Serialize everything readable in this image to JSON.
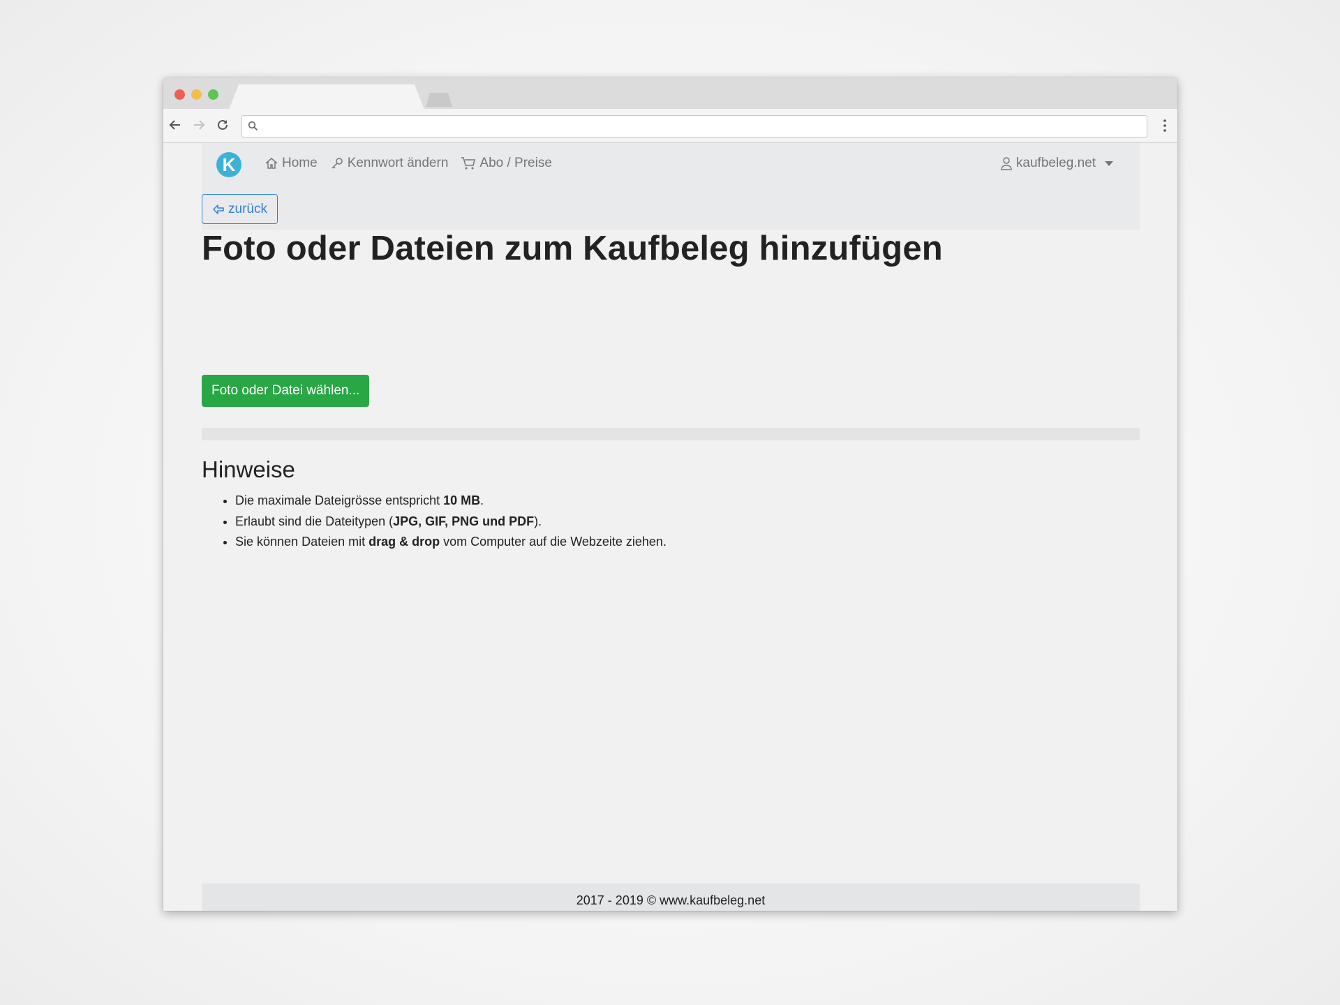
{
  "browser": {
    "address_value": "",
    "icons": [
      "back-arrow-icon",
      "forward-arrow-icon",
      "reload-icon",
      "search-icon",
      "menu-dots-icon"
    ]
  },
  "navbar": {
    "brand_letter": "K",
    "links": [
      {
        "label": "Home",
        "icon": "home-icon"
      },
      {
        "label": "Kennwort ändern",
        "icon": "key-icon"
      },
      {
        "label": "Abo / Preise",
        "icon": "cart-icon"
      }
    ],
    "user_label": "kaufbeleg.net",
    "back_label": "zurück"
  },
  "main": {
    "title": "Foto oder Dateien zum Kaufbeleg hinzufügen",
    "choose_button": "Foto oder Datei wählen...",
    "upload_progress": 0,
    "hints_heading": "Hinweise",
    "hints": [
      {
        "pre": "Die maximale Dateigrösse entspricht ",
        "bold": "10 MB",
        "post": "."
      },
      {
        "pre": "Erlaubt sind die Dateitypen (",
        "bold": "JPG, GIF, PNG und PDF",
        "post": ")."
      },
      {
        "pre": "Sie können Dateien mit ",
        "bold": "drag & drop",
        "post": " vom Computer auf die Webzeite ziehen."
      }
    ]
  },
  "footer": {
    "text": "2017 - 2019 © www.kaufbeleg.net"
  },
  "colors": {
    "primary": "#2f7fdb",
    "success": "#29a745",
    "brand": "#3bb2d6"
  }
}
